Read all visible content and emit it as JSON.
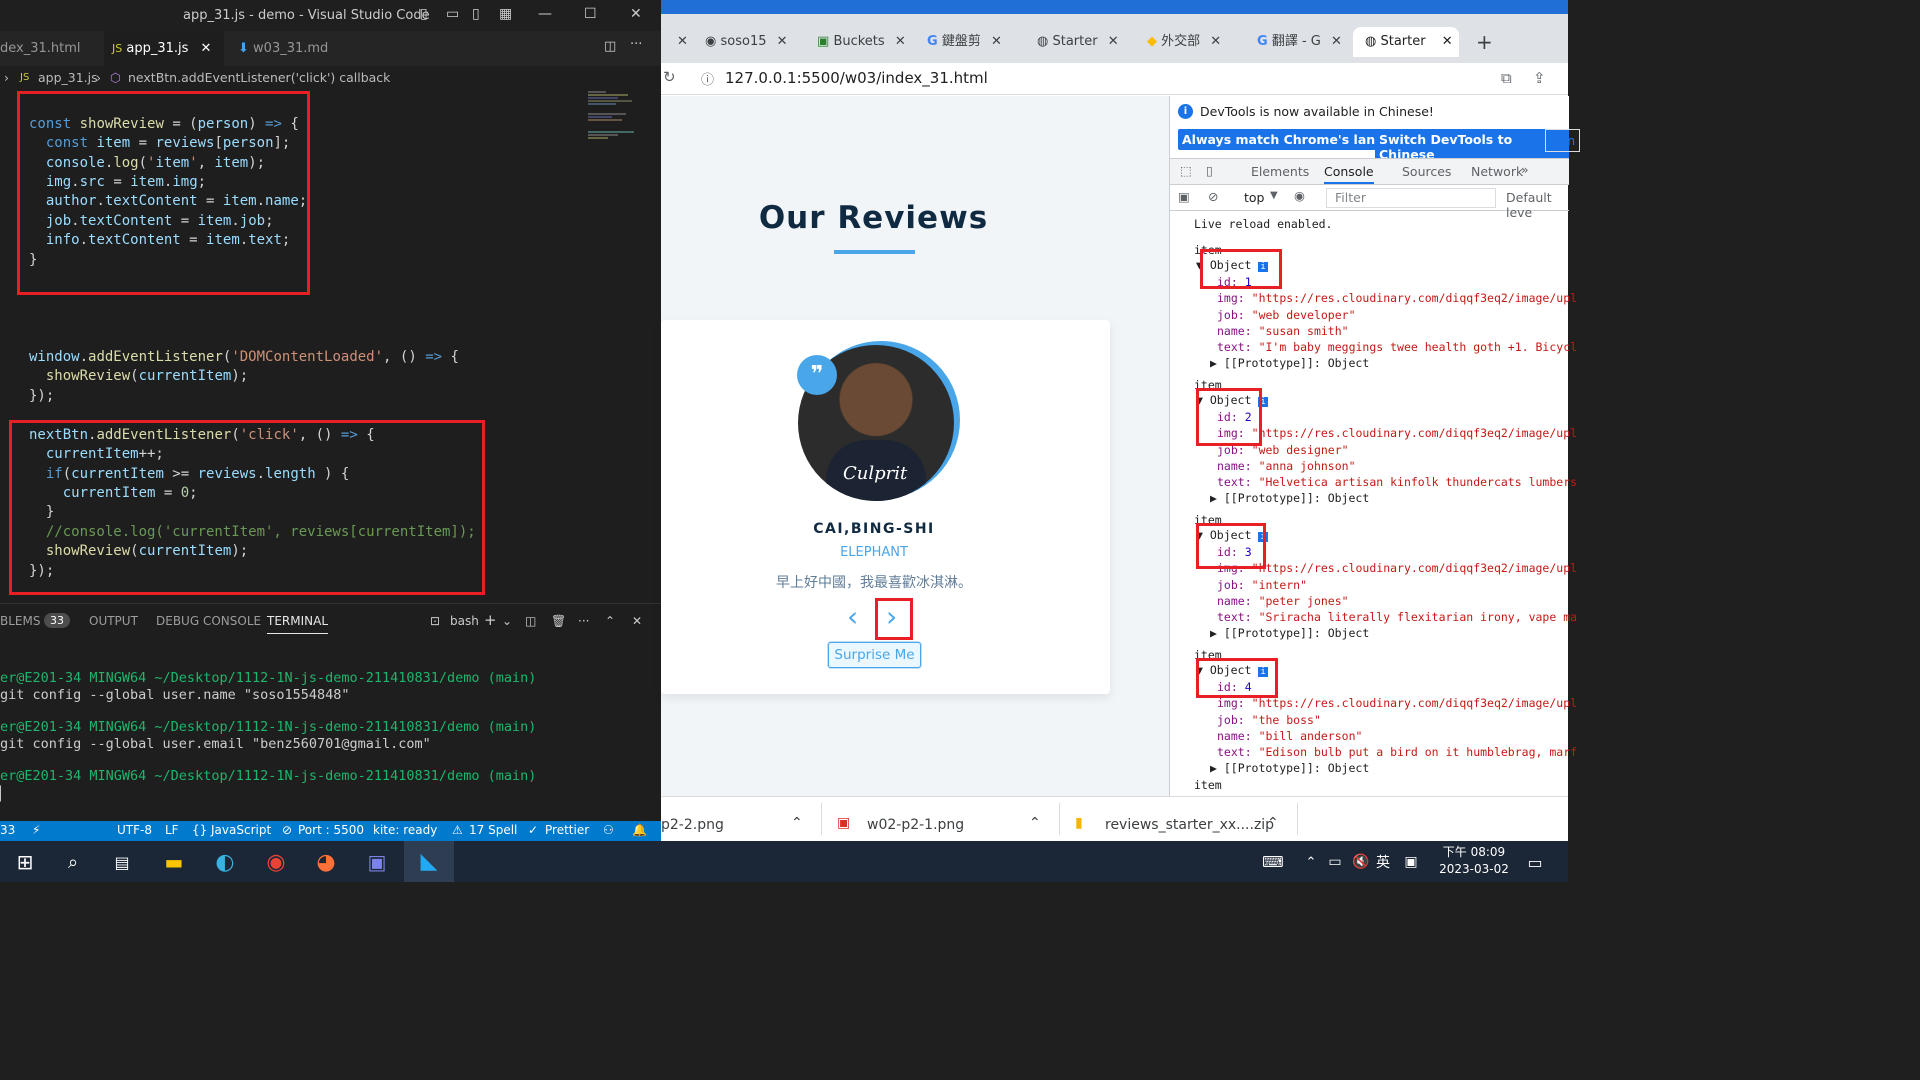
{
  "vscode": {
    "title": "app_31.js - demo - Visual Studio Code",
    "tabs": [
      "dex_31.html",
      "app_31.js",
      "w03_31.md"
    ],
    "breadcrumb": {
      "file": "app_31.js",
      "symbol": "nextBtn.addEventListener('click') callback"
    },
    "code": [
      "const showReview = (person) => {",
      "  const item = reviews[person];",
      "  console.log('item', item);",
      "  img.src = item.img;",
      "  author.textContent = item.name;",
      "  job.textContent = item.job;",
      "  info.textContent = item.text;",
      "}",
      "window.addEventListener('DOMContentLoaded', () => {",
      "  showReview(currentItem);",
      "});",
      "nextBtn.addEventListener('click', () => {",
      "  currentItem++;",
      "  if(currentItem >= reviews.length ) {",
      "    currentItem = 0;",
      "  }",
      "  //console.log('currentItem', reviews[currentItem]);",
      "  showReview(currentItem);",
      "});"
    ],
    "panel_tabs": [
      "BLEMS",
      "33",
      "OUTPUT",
      "DEBUG CONSOLE",
      "TERMINAL"
    ],
    "shell": "bash",
    "terminal": [
      {
        "prompt": "er@E201-34 MINGW64 ~/Desktop/1112-1N-js-demo-211410831/demo (main)",
        "cmd": "git config --global user.name \"soso1554848\""
      },
      {
        "prompt": "er@E201-34 MINGW64 ~/Desktop/1112-1N-js-demo-211410831/demo (main)",
        "cmd": "git config --global user.email \"benz560701@gmail.com\""
      },
      {
        "prompt": "er@E201-34 MINGW64 ~/Desktop/1112-1N-js-demo-211410831/demo (main)",
        "cmd": ""
      }
    ],
    "status": [
      "33",
      "UTF-8",
      "LF",
      "JavaScript",
      "Port : 5500",
      "kite: ready",
      "17 Spell",
      "Prettier"
    ]
  },
  "chrome": {
    "tabs": [
      "soso15",
      "Buckets",
      "鍵盤剪",
      "Starter",
      "外交部",
      "翻譯 - G",
      "Starter"
    ],
    "url": "127.0.0.1:5500/w03/index_31.html",
    "page": {
      "title": "Our Reviews",
      "author": "CAI,BING-SHI",
      "job": "ELEPHANT",
      "info": "早上好中國，我最喜歡冰淇淋。",
      "prev": "‹",
      "next": "›",
      "random": "Surprise Me",
      "quote": "❞",
      "shirt": "Culprit"
    },
    "downloads": [
      "p2-2.png",
      "w02-p2-1.png",
      "reviews_starter_xx....zip"
    ]
  },
  "devtools": {
    "info": "DevTools is now available in Chinese!",
    "btn1": "Always match Chrome's language",
    "btn2": "Switch DevTools to Chinese",
    "btn3": "Don",
    "tabs": [
      "Elements",
      "Console",
      "Sources",
      "Network"
    ],
    "context": "top",
    "filter": "Filter",
    "levels": "Default leve",
    "live": "Live reload enabled.",
    "objects": [
      {
        "id": "1",
        "img": "\"https://res.cloudinary.com/diqqf3eq2/image/upl",
        "job": "\"web developer\"",
        "name": "\"susan smith\"",
        "text": "\"I'm baby meggings twee health goth +1. Bicycl"
      },
      {
        "id": "2",
        "img": "\"https://res.cloudinary.com/diqqf3eq2/image/upl",
        "job": "\"web designer\"",
        "name": "\"anna johnson\"",
        "text": "\"Helvetica artisan kinfolk thundercats lumbers"
      },
      {
        "id": "3",
        "img": "\"https://res.cloudinary.com/diqqf3eq2/image/upl",
        "job": "\"intern\"",
        "name": "\"peter jones\"",
        "text": "\"Sriracha literally flexitarian irony, vape ma"
      },
      {
        "id": "4",
        "img": "\"https://res.cloudinary.com/diqqf3eq2/image/upl",
        "job": "\"the boss\"",
        "name": "\"bill anderson\"",
        "text": "\"Edison bulb put a bird on it humblebrag, marf"
      }
    ],
    "log_label": "item",
    "obj_label": "Object",
    "proto": "[[Prototype]]: Object"
  },
  "taskbar": {
    "time": "下午 08:09",
    "date": "2023-03-02",
    "ime": "英"
  }
}
